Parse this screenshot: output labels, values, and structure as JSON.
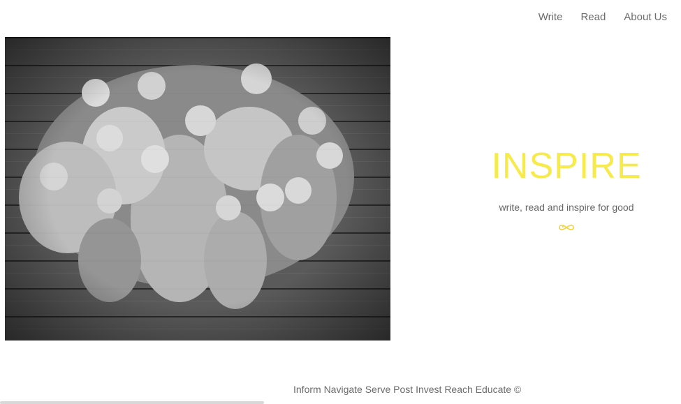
{
  "nav": {
    "items": [
      {
        "label": "Write"
      },
      {
        "label": "Read"
      },
      {
        "label": "About Us"
      }
    ]
  },
  "hero": {
    "title": "INSPIRE",
    "tagline": "write, read and inspire for good",
    "icon": "infinity-icon",
    "accent_color": "#f7ea4b",
    "photo": "black-and-white group photo of children lying on wooden floor"
  },
  "footer": {
    "text": "Inform Navigate Serve Post Invest Reach Educate ©"
  }
}
